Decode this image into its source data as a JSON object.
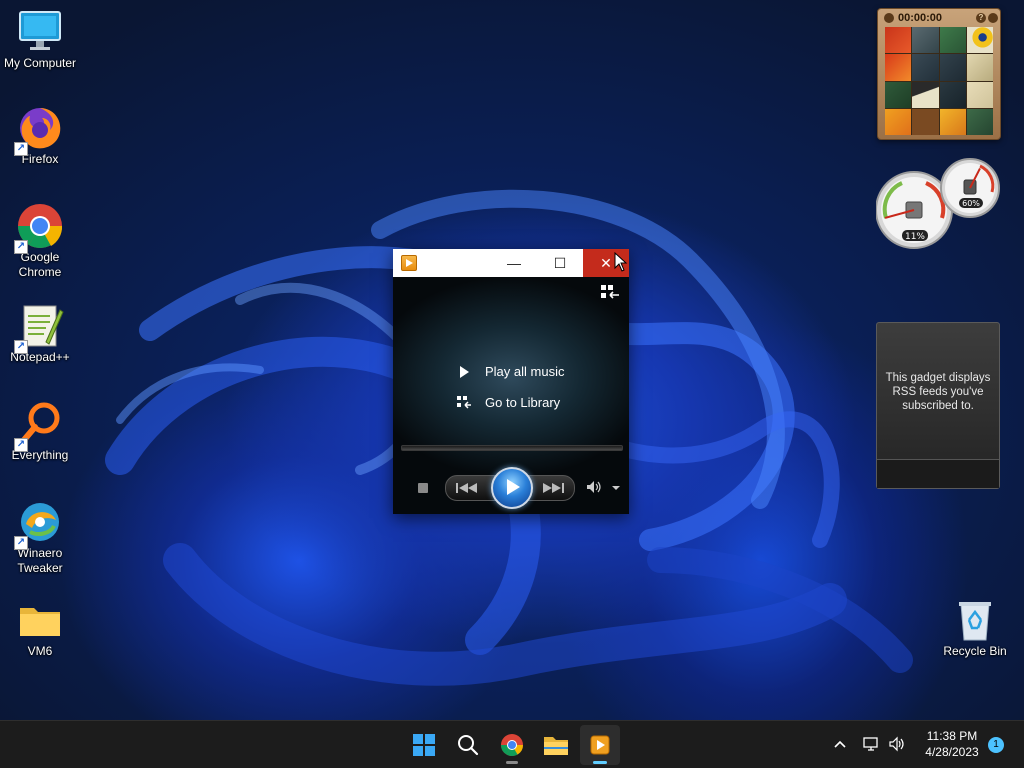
{
  "desktop_icons": [
    {
      "name": "My Computer",
      "shortcut": false
    },
    {
      "name": "Firefox",
      "shortcut": true
    },
    {
      "name": "Google Chrome",
      "shortcut": true
    },
    {
      "name": "Notepad++",
      "shortcut": true
    },
    {
      "name": "Everything",
      "shortcut": true
    },
    {
      "name": "Winaero Tweaker",
      "shortcut": true
    },
    {
      "name": "VM6",
      "shortcut": false
    },
    {
      "name": "Recycle Bin",
      "shortcut": false
    }
  ],
  "media_player": {
    "title_buttons": {
      "minimize": "—",
      "maximize": "☐",
      "close": "✕"
    },
    "menu": {
      "play_all": "Play all music",
      "go_to_library": "Go to Library"
    }
  },
  "gadgets": {
    "puzzle": {
      "timer": "00:00:00",
      "help": "?"
    },
    "cpu_meter": {
      "cpu": "11%",
      "memory": "60%",
      "cpu_level": 0.11,
      "memory_level": 0.6
    },
    "rss": {
      "text": "This gadget displays RSS feeds you've subscribed to."
    }
  },
  "taskbar": {
    "items": [
      "start",
      "search",
      "chrome",
      "file-explorer",
      "media-player"
    ],
    "clock_time": "11:38 PM",
    "clock_date": "4/28/2023",
    "notification_count": "1"
  },
  "colors": {
    "close_red": "#c42b1c",
    "accent": "#60cdff",
    "taskbar_bg": "#1c1c1c"
  }
}
